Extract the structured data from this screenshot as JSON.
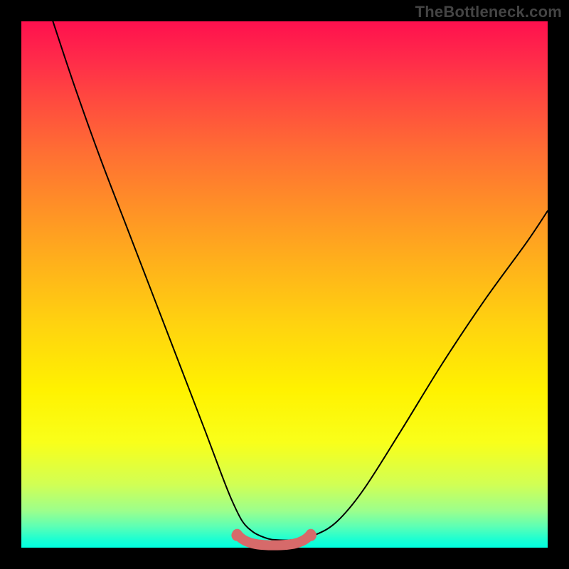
{
  "watermark": "TheBottleneck.com",
  "chart_data": {
    "type": "line",
    "title": "",
    "xlabel": "",
    "ylabel": "",
    "xlim": [
      0,
      100
    ],
    "ylim": [
      0,
      100
    ],
    "series": [
      {
        "name": "bottleneck-curve",
        "x": [
          6,
          10,
          15,
          20,
          25,
          30,
          35,
          38,
          40,
          42,
          44,
          46,
          48,
          52,
          56,
          60,
          65,
          72,
          80,
          88,
          96,
          100
        ],
        "values": [
          100,
          88,
          74,
          61,
          48,
          35,
          22,
          14,
          9,
          5,
          3,
          2,
          1.5,
          1.5,
          2.5,
          5,
          11,
          22,
          35,
          47,
          58,
          64
        ]
      }
    ],
    "sweet_spot": {
      "x_range": [
        41,
        55
      ],
      "y_level": 1.8
    },
    "background_gradient": {
      "direction": "vertical",
      "stops": [
        {
          "pos": 0.0,
          "color": "#ff104e"
        },
        {
          "pos": 0.25,
          "color": "#ff6f33"
        },
        {
          "pos": 0.55,
          "color": "#ffd40f"
        },
        {
          "pos": 0.8,
          "color": "#f9ff1a"
        },
        {
          "pos": 0.95,
          "color": "#5cffb5"
        },
        {
          "pos": 1.0,
          "color": "#00ffe0"
        }
      ]
    }
  }
}
